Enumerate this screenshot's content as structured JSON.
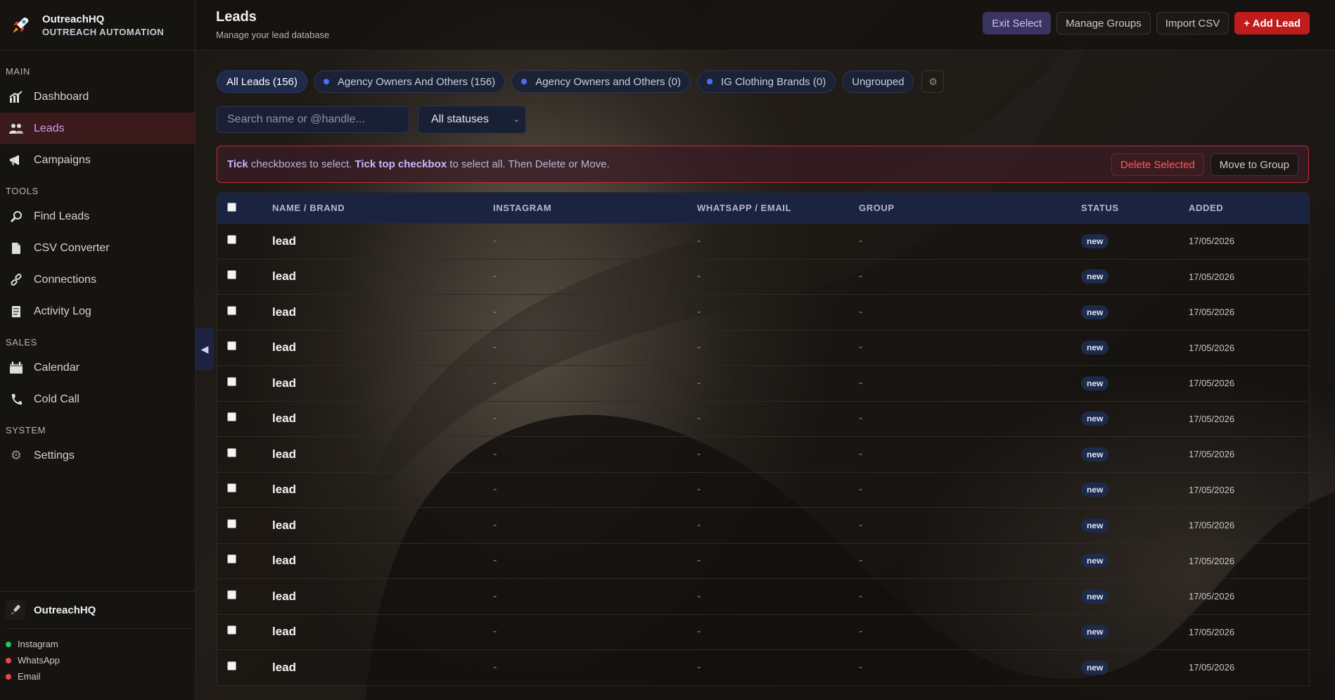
{
  "app": {
    "name": "OutreachHQ",
    "tagline": "OUTREACH AUTOMATION"
  },
  "sidebar": {
    "sections": [
      {
        "label": "MAIN",
        "items": [
          {
            "label": "Dashboard",
            "icon": "chart-icon"
          },
          {
            "label": "Leads",
            "icon": "users-icon",
            "active": true
          },
          {
            "label": "Campaigns",
            "icon": "megaphone-icon"
          }
        ]
      },
      {
        "label": "TOOLS",
        "items": [
          {
            "label": "Find Leads",
            "icon": "magnifier-icon"
          },
          {
            "label": "CSV Converter",
            "icon": "document-icon"
          },
          {
            "label": "Connections",
            "icon": "link-icon"
          },
          {
            "label": "Activity Log",
            "icon": "log-icon"
          }
        ]
      },
      {
        "label": "SALES",
        "items": [
          {
            "label": "Calendar",
            "icon": "calendar-icon"
          },
          {
            "label": "Cold Call",
            "icon": "phone-icon"
          }
        ]
      },
      {
        "label": "SYSTEM",
        "items": [
          {
            "label": "Settings",
            "icon": "gear-icon"
          }
        ]
      }
    ],
    "footer": {
      "brand": "OutreachHQ",
      "connections": [
        {
          "label": "Instagram",
          "color": "#22c55e"
        },
        {
          "label": "WhatsApp",
          "color": "#ef4444"
        },
        {
          "label": "Email",
          "color": "#ef4444"
        }
      ]
    }
  },
  "header": {
    "title": "Leads",
    "subtitle": "Manage your lead database",
    "actions": {
      "exit_select": "Exit Select",
      "manage_groups": "Manage Groups",
      "import_csv": "Import CSV",
      "add_lead": "+ Add Lead"
    }
  },
  "filters": {
    "chips": [
      {
        "label": "All Leads (156)",
        "active": true,
        "dot": false
      },
      {
        "label": "Agency Owners And Others (156)",
        "active": false,
        "dot": true
      },
      {
        "label": "Agency Owners and Others (0)",
        "active": false,
        "dot": true
      },
      {
        "label": "IG Clothing Brands (0)",
        "active": false,
        "dot": true
      },
      {
        "label": "Ungrouped",
        "active": false,
        "dot": false
      }
    ],
    "search_placeholder": "Search name or @handle...",
    "status_select": "All statuses"
  },
  "hint": {
    "part1_bold": "Tick",
    "part1": " checkboxes to select. ",
    "part2_bold": "Tick top checkbox",
    "part2": " to select all. Then Delete or Move.",
    "delete_label": "Delete Selected",
    "move_label": "Move to Group"
  },
  "table": {
    "columns": [
      "NAME / BRAND",
      "INSTAGRAM",
      "WHATSAPP / EMAIL",
      "GROUP",
      "STATUS",
      "ADDED"
    ],
    "rows": [
      {
        "name": "lead",
        "instagram": "-",
        "contact": "-",
        "group": "-",
        "status": "new",
        "added": "17/05/2026"
      },
      {
        "name": "lead",
        "instagram": "-",
        "contact": "-",
        "group": "-",
        "status": "new",
        "added": "17/05/2026"
      },
      {
        "name": "lead",
        "instagram": "-",
        "contact": "-",
        "group": "-",
        "status": "new",
        "added": "17/05/2026"
      },
      {
        "name": "lead",
        "instagram": "-",
        "contact": "-",
        "group": "-",
        "status": "new",
        "added": "17/05/2026"
      },
      {
        "name": "lead",
        "instagram": "-",
        "contact": "-",
        "group": "-",
        "status": "new",
        "added": "17/05/2026"
      },
      {
        "name": "lead",
        "instagram": "-",
        "contact": "-",
        "group": "-",
        "status": "new",
        "added": "17/05/2026"
      },
      {
        "name": "lead",
        "instagram": "-",
        "contact": "-",
        "group": "-",
        "status": "new",
        "added": "17/05/2026"
      },
      {
        "name": "lead",
        "instagram": "-",
        "contact": "-",
        "group": "-",
        "status": "new",
        "added": "17/05/2026"
      },
      {
        "name": "lead",
        "instagram": "-",
        "contact": "-",
        "group": "-",
        "status": "new",
        "added": "17/05/2026"
      },
      {
        "name": "lead",
        "instagram": "-",
        "contact": "-",
        "group": "-",
        "status": "new",
        "added": "17/05/2026"
      },
      {
        "name": "lead",
        "instagram": "-",
        "contact": "-",
        "group": "-",
        "status": "new",
        "added": "17/05/2026"
      },
      {
        "name": "lead",
        "instagram": "-",
        "contact": "-",
        "group": "-",
        "status": "new",
        "added": "17/05/2026"
      },
      {
        "name": "lead",
        "instagram": "-",
        "contact": "-",
        "group": "-",
        "status": "new",
        "added": "17/05/2026"
      }
    ]
  }
}
